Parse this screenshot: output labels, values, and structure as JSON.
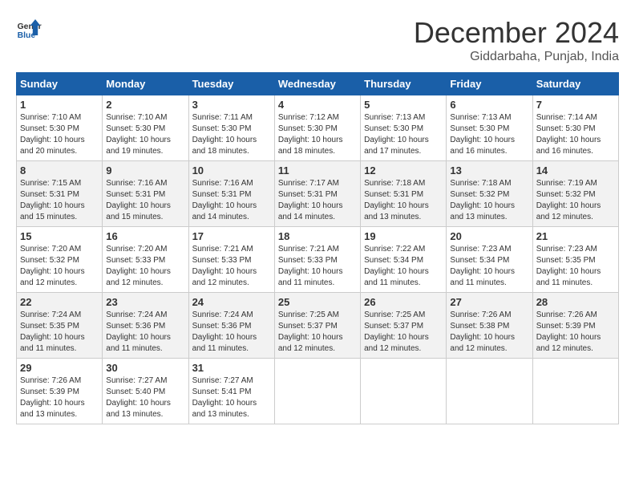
{
  "logo": {
    "line1": "General",
    "line2": "Blue"
  },
  "title": "December 2024",
  "location": "Giddarbaha, Punjab, India",
  "days_of_week": [
    "Sunday",
    "Monday",
    "Tuesday",
    "Wednesday",
    "Thursday",
    "Friday",
    "Saturday"
  ],
  "weeks": [
    [
      {
        "day": "1",
        "sunrise": "7:10 AM",
        "sunset": "5:30 PM",
        "daylight": "10 hours and 20 minutes."
      },
      {
        "day": "2",
        "sunrise": "7:10 AM",
        "sunset": "5:30 PM",
        "daylight": "10 hours and 19 minutes."
      },
      {
        "day": "3",
        "sunrise": "7:11 AM",
        "sunset": "5:30 PM",
        "daylight": "10 hours and 18 minutes."
      },
      {
        "day": "4",
        "sunrise": "7:12 AM",
        "sunset": "5:30 PM",
        "daylight": "10 hours and 18 minutes."
      },
      {
        "day": "5",
        "sunrise": "7:13 AM",
        "sunset": "5:30 PM",
        "daylight": "10 hours and 17 minutes."
      },
      {
        "day": "6",
        "sunrise": "7:13 AM",
        "sunset": "5:30 PM",
        "daylight": "10 hours and 16 minutes."
      },
      {
        "day": "7",
        "sunrise": "7:14 AM",
        "sunset": "5:30 PM",
        "daylight": "10 hours and 16 minutes."
      }
    ],
    [
      {
        "day": "8",
        "sunrise": "7:15 AM",
        "sunset": "5:31 PM",
        "daylight": "10 hours and 15 minutes."
      },
      {
        "day": "9",
        "sunrise": "7:16 AM",
        "sunset": "5:31 PM",
        "daylight": "10 hours and 15 minutes."
      },
      {
        "day": "10",
        "sunrise": "7:16 AM",
        "sunset": "5:31 PM",
        "daylight": "10 hours and 14 minutes."
      },
      {
        "day": "11",
        "sunrise": "7:17 AM",
        "sunset": "5:31 PM",
        "daylight": "10 hours and 14 minutes."
      },
      {
        "day": "12",
        "sunrise": "7:18 AM",
        "sunset": "5:31 PM",
        "daylight": "10 hours and 13 minutes."
      },
      {
        "day": "13",
        "sunrise": "7:18 AM",
        "sunset": "5:32 PM",
        "daylight": "10 hours and 13 minutes."
      },
      {
        "day": "14",
        "sunrise": "7:19 AM",
        "sunset": "5:32 PM",
        "daylight": "10 hours and 12 minutes."
      }
    ],
    [
      {
        "day": "15",
        "sunrise": "7:20 AM",
        "sunset": "5:32 PM",
        "daylight": "10 hours and 12 minutes."
      },
      {
        "day": "16",
        "sunrise": "7:20 AM",
        "sunset": "5:33 PM",
        "daylight": "10 hours and 12 minutes."
      },
      {
        "day": "17",
        "sunrise": "7:21 AM",
        "sunset": "5:33 PM",
        "daylight": "10 hours and 12 minutes."
      },
      {
        "day": "18",
        "sunrise": "7:21 AM",
        "sunset": "5:33 PM",
        "daylight": "10 hours and 11 minutes."
      },
      {
        "day": "19",
        "sunrise": "7:22 AM",
        "sunset": "5:34 PM",
        "daylight": "10 hours and 11 minutes."
      },
      {
        "day": "20",
        "sunrise": "7:23 AM",
        "sunset": "5:34 PM",
        "daylight": "10 hours and 11 minutes."
      },
      {
        "day": "21",
        "sunrise": "7:23 AM",
        "sunset": "5:35 PM",
        "daylight": "10 hours and 11 minutes."
      }
    ],
    [
      {
        "day": "22",
        "sunrise": "7:24 AM",
        "sunset": "5:35 PM",
        "daylight": "10 hours and 11 minutes."
      },
      {
        "day": "23",
        "sunrise": "7:24 AM",
        "sunset": "5:36 PM",
        "daylight": "10 hours and 11 minutes."
      },
      {
        "day": "24",
        "sunrise": "7:24 AM",
        "sunset": "5:36 PM",
        "daylight": "10 hours and 11 minutes."
      },
      {
        "day": "25",
        "sunrise": "7:25 AM",
        "sunset": "5:37 PM",
        "daylight": "10 hours and 12 minutes."
      },
      {
        "day": "26",
        "sunrise": "7:25 AM",
        "sunset": "5:37 PM",
        "daylight": "10 hours and 12 minutes."
      },
      {
        "day": "27",
        "sunrise": "7:26 AM",
        "sunset": "5:38 PM",
        "daylight": "10 hours and 12 minutes."
      },
      {
        "day": "28",
        "sunrise": "7:26 AM",
        "sunset": "5:39 PM",
        "daylight": "10 hours and 12 minutes."
      }
    ],
    [
      {
        "day": "29",
        "sunrise": "7:26 AM",
        "sunset": "5:39 PM",
        "daylight": "10 hours and 13 minutes."
      },
      {
        "day": "30",
        "sunrise": "7:27 AM",
        "sunset": "5:40 PM",
        "daylight": "10 hours and 13 minutes."
      },
      {
        "day": "31",
        "sunrise": "7:27 AM",
        "sunset": "5:41 PM",
        "daylight": "10 hours and 13 minutes."
      },
      null,
      null,
      null,
      null
    ]
  ],
  "labels": {
    "sunrise": "Sunrise:",
    "sunset": "Sunset:",
    "daylight": "Daylight:"
  }
}
